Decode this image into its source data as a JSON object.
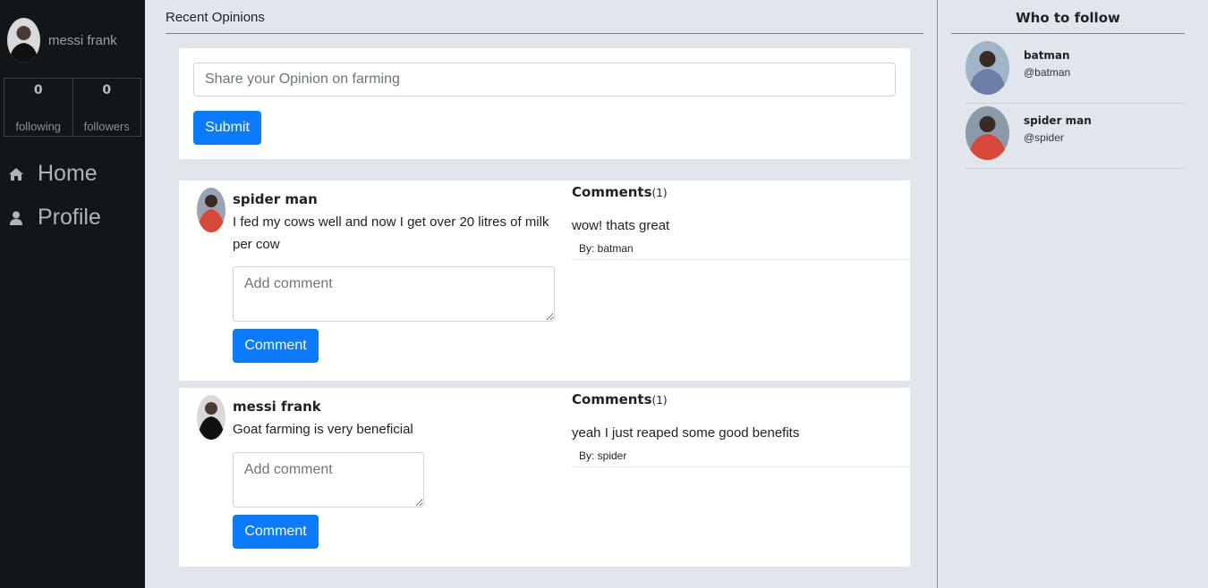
{
  "user": {
    "name": "messi frank"
  },
  "stats": [
    {
      "value": "0",
      "label": "following"
    },
    {
      "value": "0",
      "label": "followers"
    }
  ],
  "nav": [
    {
      "label": "Home",
      "icon": "home-icon"
    },
    {
      "label": "Profile",
      "icon": "user-icon"
    }
  ],
  "feed": {
    "title": "Recent Opinions",
    "composer": {
      "placeholder": "Share your Opinion on farming",
      "submit_label": "Submit"
    },
    "posts": [
      {
        "author": "spider man",
        "text": "I fed my cows well and now I get over 20 litres of milk per cow",
        "comment_placeholder": "Add comment",
        "comment_button": "Comment",
        "comments_label": "Comments",
        "comments_count": "(1)",
        "comments": [
          {
            "text": "wow! thats great",
            "by": "By: batman"
          }
        ]
      },
      {
        "author": "messi frank",
        "text": "Goat farming is very beneficial",
        "comment_placeholder": "Add comment",
        "comment_button": "Comment",
        "comments_label": "Comments",
        "comments_count": "(1)",
        "comments": [
          {
            "text": "yeah I just reaped some good benefits",
            "by": "By: spider"
          }
        ]
      }
    ]
  },
  "who_to_follow": {
    "title": "Who to follow",
    "users": [
      {
        "name": "batman",
        "handle": "@batman"
      },
      {
        "name": "spider man",
        "handle": "@spider"
      }
    ]
  },
  "colors": {
    "sidebar_bg": "#131619",
    "page_bg": "#e1e6ec",
    "primary_button": "#0a7bff"
  }
}
